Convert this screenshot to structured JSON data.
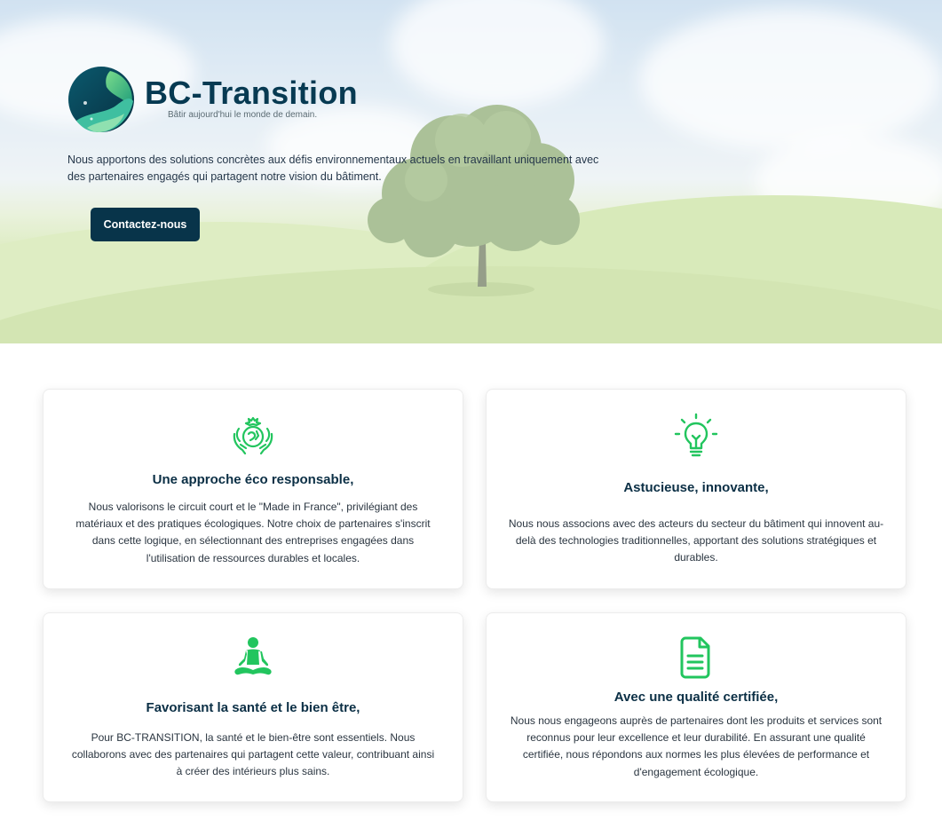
{
  "brand": {
    "name": "BC-Transition",
    "tagline": "Bâtir aujourd'hui le monde de demain."
  },
  "hero": {
    "description": "Nous apportons des solutions concrètes aux défis environnementaux actuels en travaillant uniquement avec des partenaires engagés qui partagent notre vision du bâtiment.",
    "cta_label": "Contactez-nous"
  },
  "colors": {
    "accent": "#22c55e",
    "dark_blue": "#08344a"
  },
  "cards": [
    {
      "icon": "eco-hands-icon",
      "title": "Une approche éco responsable,",
      "text": "Nous valorisons le circuit court et le \"Made in France\", privilégiant des matériaux et des pratiques écologiques. Notre choix de partenaires s'inscrit dans cette logique, en sélectionnant des entreprises engagées dans l'utilisation de ressources durables et locales."
    },
    {
      "icon": "lightbulb-icon",
      "title": "Astucieuse, innovante,",
      "text": "Nous nous associons avec des acteurs du secteur du bâtiment qui innovent au-delà des technologies traditionnelles, apportant des solutions stratégiques et durables."
    },
    {
      "icon": "meditation-icon",
      "title": "Favorisant la santé et le bien être,",
      "text": "Pour BC-TRANSITION, la santé et le bien-être sont essentiels. Nous collaborons avec des partenaires qui partagent cette valeur, contribuant ainsi à créer des intérieurs plus sains."
    },
    {
      "icon": "document-icon",
      "title": "Avec une qualité certifiée,",
      "text": "Nous nous engageons auprès de partenaires dont les produits et services sont reconnus pour leur excellence et leur durabilité. En assurant une qualité certifiée, nous répondons aux normes les plus élevées de performance et d'engagement écologique."
    }
  ]
}
